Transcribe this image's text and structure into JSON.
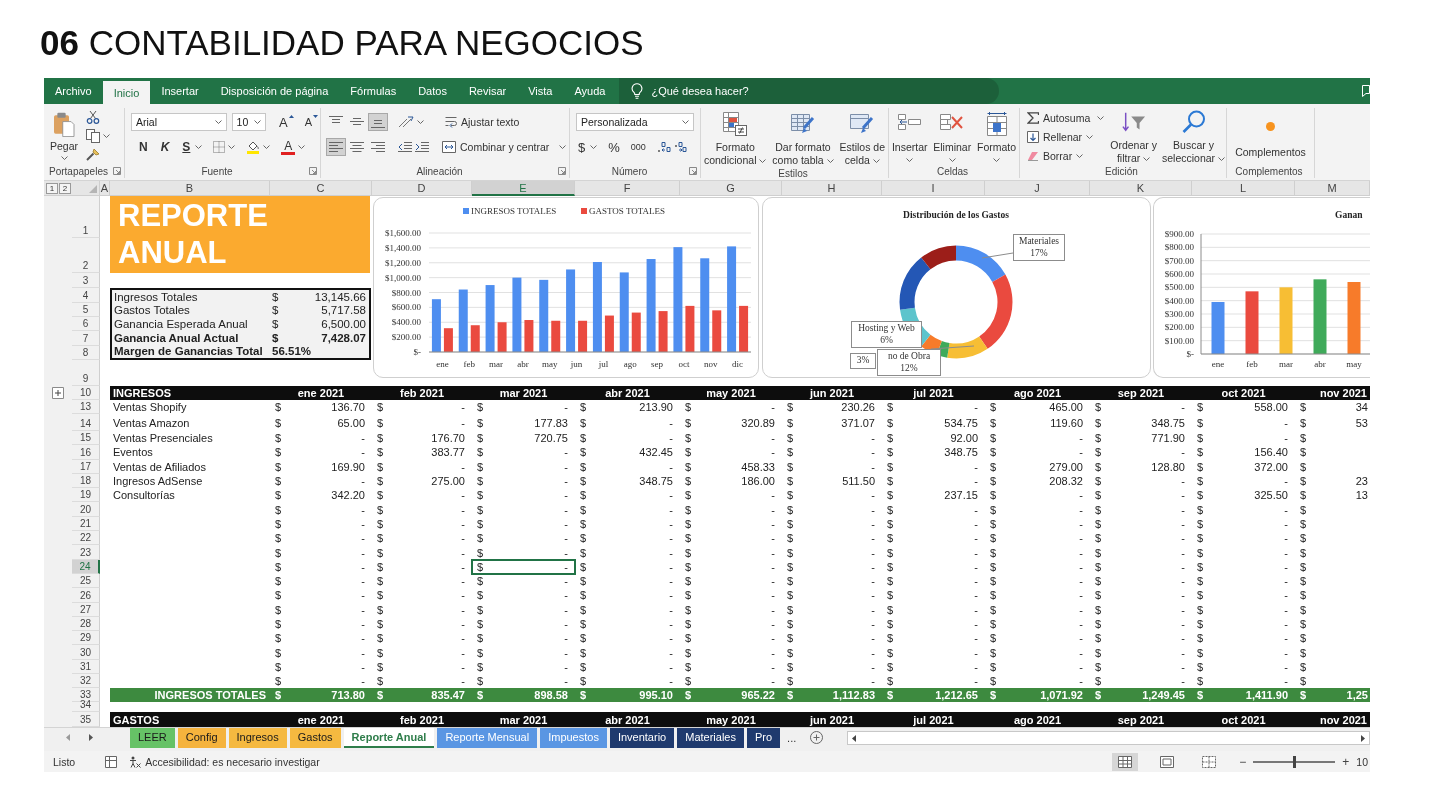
{
  "heading": {
    "text": "**06** CONTABILIDAD PARA NEGOCIOS"
  },
  "menu_tabs": [
    {
      "label": "Archivo",
      "selected": false
    },
    {
      "label": "Inicio",
      "selected": true
    },
    {
      "label": "Insertar",
      "selected": false
    },
    {
      "label": "Disposición de página",
      "selected": false
    },
    {
      "label": "Fórmulas",
      "selected": false
    },
    {
      "label": "Datos",
      "selected": false
    },
    {
      "label": "Revisar",
      "selected": false
    },
    {
      "label": "Vista",
      "selected": false
    },
    {
      "label": "Ayuda",
      "selected": false
    }
  ],
  "tell_me": {
    "placeholder": "¿Qué desea hacer?"
  },
  "ribbon": {
    "clipboard": {
      "paste": "Pegar",
      "group": "Portapapeles"
    },
    "font": {
      "family": "Arial",
      "size": "10",
      "grow": "A",
      "shrink": "A",
      "bold": "N",
      "italic": "K",
      "underline": "S",
      "tint": "A",
      "group": "Fuente"
    },
    "alignment": {
      "vertical": [
        {
          "selected": false
        },
        {
          "selected": false
        },
        {
          "selected": true
        }
      ],
      "wrap": "Ajustar texto",
      "horizontal": [
        {
          "selected": true
        },
        {
          "selected": false
        },
        {
          "selected": false
        }
      ],
      "merge": "Combinar y centrar",
      "group": "Alineación"
    },
    "number": {
      "format": "Personalizada",
      "currency": "$",
      "percent": "%",
      "thousands": "000",
      "group": "Número"
    },
    "styles": {
      "buttons": [
        {
          "lines": [
            "Formato",
            "condicional"
          ]
        },
        {
          "lines": [
            "Dar formato",
            "como tabla"
          ]
        },
        {
          "lines": [
            "Estilos de",
            "celda"
          ]
        }
      ],
      "group": "Estilos"
    },
    "cells": {
      "buttons": [
        "Insertar",
        "Eliminar",
        "Formato"
      ],
      "group": "Celdas"
    },
    "editing": {
      "autosum": "Autosuma",
      "fill": "Rellenar",
      "clear": "Borrar",
      "sort": [
        "Ordenar y",
        "filtrar"
      ],
      "find": [
        "Buscar y",
        "seleccionar"
      ],
      "group": "Edición"
    },
    "addins": {
      "button": "Complementos",
      "group": "Complementos"
    }
  },
  "sheet": {
    "outline_levels": [
      "1",
      "2"
    ],
    "columns": [
      {
        "label": "A",
        "selected": false
      },
      {
        "label": "B",
        "selected": false
      },
      {
        "label": "C",
        "selected": false
      },
      {
        "label": "D",
        "selected": false
      },
      {
        "label": "E",
        "selected": true
      },
      {
        "label": "F",
        "selected": false
      },
      {
        "label": "G",
        "selected": false
      },
      {
        "label": "H",
        "selected": false
      },
      {
        "label": "I",
        "selected": false
      },
      {
        "label": "J",
        "selected": false
      },
      {
        "label": "K",
        "selected": false
      },
      {
        "label": "L",
        "selected": false
      },
      {
        "label": "M",
        "selected": false
      }
    ],
    "row_headers": [
      {
        "number": "1",
        "selected": false
      },
      {
        "number": "2",
        "selected": false
      },
      {
        "number": "3",
        "selected": false
      },
      {
        "number": "4",
        "selected": false
      },
      {
        "number": "5",
        "selected": false
      },
      {
        "number": "6",
        "selected": false
      },
      {
        "number": "7",
        "selected": false
      },
      {
        "number": "8",
        "selected": false
      },
      {
        "number": "9",
        "selected": false
      },
      {
        "number": "10",
        "selected": false
      },
      {
        "number": "13",
        "selected": false
      },
      {
        "number": "14",
        "selected": false
      },
      {
        "number": "15",
        "selected": false
      },
      {
        "number": "16",
        "selected": false
      },
      {
        "number": "17",
        "selected": false
      },
      {
        "number": "18",
        "selected": false
      },
      {
        "number": "19",
        "selected": false
      },
      {
        "number": "20",
        "selected": false
      },
      {
        "number": "21",
        "selected": false
      },
      {
        "number": "22",
        "selected": false
      },
      {
        "number": "23",
        "selected": false
      },
      {
        "number": "24",
        "selected": true
      },
      {
        "number": "25",
        "selected": false
      },
      {
        "number": "26",
        "selected": false
      },
      {
        "number": "27",
        "selected": false
      },
      {
        "number": "28",
        "selected": false
      },
      {
        "number": "29",
        "selected": false
      },
      {
        "number": "30",
        "selected": false
      },
      {
        "number": "31",
        "selected": false
      },
      {
        "number": "32",
        "selected": false
      },
      {
        "number": "33",
        "selected": false
      },
      {
        "number": "34",
        "selected": false
      },
      {
        "number": "35",
        "selected": false
      }
    ],
    "report_title": [
      "REPORTE",
      "ANUAL"
    ],
    "summary": [
      {
        "label": "Ingresos Totales",
        "currency": "$",
        "value": "13,145.66",
        "bold": false
      },
      {
        "label": "Gastos Totales",
        "currency": "$",
        "value": "5,717.58",
        "bold": false
      },
      {
        "label": "Ganancia Esperada Anual",
        "currency": "$",
        "value": "6,500.00",
        "bold": false
      },
      {
        "label": "Ganancia Anual Actual",
        "currency": "$",
        "value": "7,428.07",
        "bold": true
      },
      {
        "label": "Margen de Ganancias Total",
        "value": "56.51%",
        "bold": true
      }
    ],
    "income_chart": {
      "chart_data": {
        "type": "bar",
        "categories": [
          "ene",
          "feb",
          "mar",
          "abr",
          "may",
          "jun",
          "jul",
          "ago",
          "sep",
          "oct",
          "nov",
          "dic"
        ],
        "series": [
          {
            "name": "INGRESOS TOTALES",
            "color": "#4e8ef0",
            "values": [
              710,
              840,
              900,
              1000,
              970,
              1110,
              1210,
              1070,
              1250,
              1410,
              1260,
              1420
            ]
          },
          {
            "name": "GASTOS TOTALES",
            "color": "#ea4a3f",
            "values": [
              320,
              360,
              400,
              430,
              420,
              420,
              490,
              530,
              550,
              620,
              560,
              620
            ]
          }
        ],
        "legend": "top",
        "grid": true,
        "ylim": [
          0,
          1600
        ],
        "yticks": [
          {
            "value": 0,
            "label": "$-"
          },
          {
            "value": 200,
            "label": "$200.00"
          },
          {
            "value": 400,
            "label": "$400.00"
          },
          {
            "value": 600,
            "label": "$600.00"
          },
          {
            "value": 800,
            "label": "$800.00"
          },
          {
            "value": 1000,
            "label": "$1,000.00"
          },
          {
            "value": 1200,
            "label": "$1,200.00"
          },
          {
            "value": 1400,
            "label": "$1,400.00"
          },
          {
            "value": 1600,
            "label": "$1,600.00"
          }
        ]
      }
    },
    "expense_distribution": {
      "title": "Distribución de los Gastos",
      "slices": [
        {
          "color": "#4e8ef0"
        },
        {
          "color": "#ea4a3f"
        },
        {
          "color": "#f7be34"
        },
        {
          "color": "#3faa5a"
        },
        {
          "color": "#f77b2a"
        },
        {
          "color": "#5cc4cc"
        },
        {
          "color": "#2457b5"
        },
        {
          "color": "#9c1e19"
        }
      ],
      "callouts": [
        {
          "name": "Materiales",
          "value": "17%"
        },
        {
          "name": "Hosting y Web",
          "value": "6%"
        },
        {
          "value": "3%"
        },
        {
          "name": "no de Obra",
          "value": "12%"
        }
      ]
    },
    "profit_chart": {
      "chart_data": {
        "type": "bar",
        "title": "Ganan",
        "categories": [
          "ene",
          "feb",
          "mar",
          "abr",
          "may"
        ],
        "series": [
          {
            "values": [
              390,
              470,
              500,
              560,
              540
            ]
          }
        ],
        "colors": [
          "#4e8ef0",
          "#ea4a3f",
          "#f7be34",
          "#3faa5a",
          "#f77b2a"
        ],
        "grid": true,
        "ylim": [
          0,
          900
        ],
        "yticks": [
          {
            "value": 0,
            "label": "$-"
          },
          {
            "value": 100,
            "label": "$100.00"
          },
          {
            "value": 200,
            "label": "$200.00"
          },
          {
            "value": 300,
            "label": "$300.00"
          },
          {
            "value": 400,
            "label": "$400.00"
          },
          {
            "value": 500,
            "label": "$500.00"
          },
          {
            "value": 600,
            "label": "$600.00"
          },
          {
            "value": 700,
            "label": "$700.00"
          },
          {
            "value": 800,
            "label": "$800.00"
          },
          {
            "value": 900,
            "label": "$900.00"
          }
        ]
      }
    },
    "income": {
      "title": "INGRESOS",
      "months": [
        "ene 2021",
        "feb 2021",
        "mar 2021",
        "abr 2021",
        "may 2021",
        "jun 2021",
        "jul 2021",
        "ago 2021",
        "sep 2021",
        "oct 2021",
        "nov 2021"
      ],
      "rows": [
        {
          "label": "Ventas Shopify",
          "cells": [
            [
              "$",
              "136.70"
            ],
            [
              "$",
              "-"
            ],
            [
              "$",
              "-"
            ],
            [
              "$",
              "213.90"
            ],
            [
              "$",
              "-"
            ],
            [
              "$",
              "230.26"
            ],
            [
              "$",
              "-"
            ],
            [
              "$",
              "465.00"
            ],
            [
              "$",
              "-"
            ],
            [
              "$",
              "558.00"
            ],
            [
              "$",
              "34"
            ]
          ]
        },
        {
          "label": "Ventas Amazon",
          "cells": [
            [
              "$",
              "65.00"
            ],
            [
              "$",
              "-"
            ],
            [
              "$",
              "177.83"
            ],
            [
              "$",
              "-"
            ],
            [
              "$",
              "320.89"
            ],
            [
              "$",
              "371.07"
            ],
            [
              "$",
              "534.75"
            ],
            [
              "$",
              "119.60"
            ],
            [
              "$",
              "348.75"
            ],
            [
              "$",
              "-"
            ],
            [
              "$",
              "53"
            ]
          ]
        },
        {
          "label": "Ventas Presenciales",
          "cells": [
            [
              "$",
              "-"
            ],
            [
              "$",
              "176.70"
            ],
            [
              "$",
              "720.75"
            ],
            [
              "$",
              "-"
            ],
            [
              "$",
              "-"
            ],
            [
              "$",
              "-"
            ],
            [
              "$",
              "92.00"
            ],
            [
              "$",
              "-"
            ],
            [
              "$",
              "771.90"
            ],
            [
              "$",
              "-"
            ],
            [
              "$"
            ]
          ]
        },
        {
          "label": "Eventos",
          "cells": [
            [
              "$",
              "-"
            ],
            [
              "$",
              "383.77"
            ],
            [
              "$",
              "-"
            ],
            [
              "$",
              "432.45"
            ],
            [
              "$",
              "-"
            ],
            [
              "$",
              "-"
            ],
            [
              "$",
              "348.75"
            ],
            [
              "$",
              "-"
            ],
            [
              "$",
              "-"
            ],
            [
              "$",
              "156.40"
            ],
            [
              "$"
            ]
          ]
        },
        {
          "label": "Ventas de Afiliados",
          "cells": [
            [
              "$",
              "169.90"
            ],
            [
              "$",
              "-"
            ],
            [
              "$",
              "-"
            ],
            [
              "$",
              "-"
            ],
            [
              "$",
              "458.33"
            ],
            [
              "$",
              "-"
            ],
            [
              "$",
              "-"
            ],
            [
              "$",
              "279.00"
            ],
            [
              "$",
              "128.80"
            ],
            [
              "$",
              "372.00"
            ],
            [
              "$"
            ]
          ]
        },
        {
          "label": "Ingresos AdSense",
          "cells": [
            [
              "$",
              "-"
            ],
            [
              "$",
              "275.00"
            ],
            [
              "$",
              "-"
            ],
            [
              "$",
              "348.75"
            ],
            [
              "$",
              "186.00"
            ],
            [
              "$",
              "511.50"
            ],
            [
              "$",
              "-"
            ],
            [
              "$",
              "208.32"
            ],
            [
              "$",
              "-"
            ],
            [
              "$",
              "-"
            ],
            [
              "$",
              "23"
            ]
          ]
        },
        {
          "label": "Consultorías",
          "cells": [
            [
              "$",
              "342.20"
            ],
            [
              "$",
              "-"
            ],
            [
              "$",
              "-"
            ],
            [
              "$",
              "-"
            ],
            [
              "$",
              "-"
            ],
            [
              "$",
              "-"
            ],
            [
              "$",
              "237.15"
            ],
            [
              "$",
              "-"
            ],
            [
              "$",
              "-"
            ],
            [
              "$",
              "325.50"
            ],
            [
              "$",
              "13"
            ]
          ]
        },
        {
          "cells": [
            [
              "$",
              "-"
            ],
            [
              "$",
              "-"
            ],
            [
              "$",
              "-"
            ],
            [
              "$",
              "-"
            ],
            [
              "$",
              "-"
            ],
            [
              "$",
              "-"
            ],
            [
              "$",
              "-"
            ],
            [
              "$",
              "-"
            ],
            [
              "$",
              "-"
            ],
            [
              "$",
              "-"
            ],
            [
              "$"
            ]
          ]
        },
        {
          "cells": [
            [
              "$",
              "-"
            ],
            [
              "$",
              "-"
            ],
            [
              "$",
              "-"
            ],
            [
              "$",
              "-"
            ],
            [
              "$",
              "-"
            ],
            [
              "$",
              "-"
            ],
            [
              "$",
              "-"
            ],
            [
              "$",
              "-"
            ],
            [
              "$",
              "-"
            ],
            [
              "$",
              "-"
            ],
            [
              "$"
            ]
          ]
        },
        {
          "cells": [
            [
              "$",
              "-"
            ],
            [
              "$",
              "-"
            ],
            [
              "$",
              "-"
            ],
            [
              "$",
              "-"
            ],
            [
              "$",
              "-"
            ],
            [
              "$",
              "-"
            ],
            [
              "$",
              "-"
            ],
            [
              "$",
              "-"
            ],
            [
              "$",
              "-"
            ],
            [
              "$",
              "-"
            ],
            [
              "$"
            ]
          ]
        },
        {
          "cells": [
            [
              "$",
              "-"
            ],
            [
              "$",
              "-"
            ],
            [
              "$",
              "-"
            ],
            [
              "$",
              "-"
            ],
            [
              "$",
              "-"
            ],
            [
              "$",
              "-"
            ],
            [
              "$",
              "-"
            ],
            [
              "$",
              "-"
            ],
            [
              "$",
              "-"
            ],
            [
              "$",
              "-"
            ],
            [
              "$"
            ]
          ]
        },
        {
          "cells": [
            [
              "$",
              "-"
            ],
            [
              "$",
              "-"
            ],
            [
              "$",
              "-"
            ],
            [
              "$",
              "-"
            ],
            [
              "$",
              "-"
            ],
            [
              "$",
              "-"
            ],
            [
              "$",
              "-"
            ],
            [
              "$",
              "-"
            ],
            [
              "$",
              "-"
            ],
            [
              "$",
              "-"
            ],
            [
              "$"
            ]
          ]
        },
        {
          "cells": [
            [
              "$",
              "-"
            ],
            [
              "$",
              "-"
            ],
            [
              "$",
              "-"
            ],
            [
              "$",
              "-"
            ],
            [
              "$",
              "-"
            ],
            [
              "$",
              "-"
            ],
            [
              "$",
              "-"
            ],
            [
              "$",
              "-"
            ],
            [
              "$",
              "-"
            ],
            [
              "$",
              "-"
            ],
            [
              "$"
            ]
          ]
        },
        {
          "cells": [
            [
              "$",
              "-"
            ],
            [
              "$",
              "-"
            ],
            [
              "$",
              "-"
            ],
            [
              "$",
              "-"
            ],
            [
              "$",
              "-"
            ],
            [
              "$",
              "-"
            ],
            [
              "$",
              "-"
            ],
            [
              "$",
              "-"
            ],
            [
              "$",
              "-"
            ],
            [
              "$",
              "-"
            ],
            [
              "$"
            ]
          ]
        },
        {
          "cells": [
            [
              "$",
              "-"
            ],
            [
              "$",
              "-"
            ],
            [
              "$",
              "-"
            ],
            [
              "$",
              "-"
            ],
            [
              "$",
              "-"
            ],
            [
              "$",
              "-"
            ],
            [
              "$",
              "-"
            ],
            [
              "$",
              "-"
            ],
            [
              "$",
              "-"
            ],
            [
              "$",
              "-"
            ],
            [
              "$"
            ]
          ]
        },
        {
          "cells": [
            [
              "$",
              "-"
            ],
            [
              "$",
              "-"
            ],
            [
              "$",
              "-"
            ],
            [
              "$",
              "-"
            ],
            [
              "$",
              "-"
            ],
            [
              "$",
              "-"
            ],
            [
              "$",
              "-"
            ],
            [
              "$",
              "-"
            ],
            [
              "$",
              "-"
            ],
            [
              "$",
              "-"
            ],
            [
              "$"
            ]
          ]
        },
        {
          "cells": [
            [
              "$",
              "-"
            ],
            [
              "$",
              "-"
            ],
            [
              "$",
              "-"
            ],
            [
              "$",
              "-"
            ],
            [
              "$",
              "-"
            ],
            [
              "$",
              "-"
            ],
            [
              "$",
              "-"
            ],
            [
              "$",
              "-"
            ],
            [
              "$",
              "-"
            ],
            [
              "$",
              "-"
            ],
            [
              "$"
            ]
          ]
        },
        {
          "cells": [
            [
              "$",
              "-"
            ],
            [
              "$",
              "-"
            ],
            [
              "$",
              "-"
            ],
            [
              "$",
              "-"
            ],
            [
              "$",
              "-"
            ],
            [
              "$",
              "-"
            ],
            [
              "$",
              "-"
            ],
            [
              "$",
              "-"
            ],
            [
              "$",
              "-"
            ],
            [
              "$",
              "-"
            ],
            [
              "$"
            ]
          ]
        },
        {
          "cells": [
            [
              "$",
              "-"
            ],
            [
              "$",
              "-"
            ],
            [
              "$",
              "-"
            ],
            [
              "$",
              "-"
            ],
            [
              "$",
              "-"
            ],
            [
              "$",
              "-"
            ],
            [
              "$",
              "-"
            ],
            [
              "$",
              "-"
            ],
            [
              "$",
              "-"
            ],
            [
              "$",
              "-"
            ],
            [
              "$"
            ]
          ]
        },
        {
          "cells": [
            [
              "$",
              "-"
            ],
            [
              "$",
              "-"
            ],
            [
              "$",
              "-"
            ],
            [
              "$",
              "-"
            ],
            [
              "$",
              "-"
            ],
            [
              "$",
              "-"
            ],
            [
              "$",
              "-"
            ],
            [
              "$",
              "-"
            ],
            [
              "$",
              "-"
            ],
            [
              "$",
              "-"
            ],
            [
              "$"
            ]
          ]
        }
      ],
      "total": {
        "label": "INGRESOS TOTALES",
        "cells": [
          [
            "$",
            "713.80"
          ],
          [
            "$",
            "835.47"
          ],
          [
            "$",
            "898.58"
          ],
          [
            "$",
            "995.10"
          ],
          [
            "$",
            "965.22"
          ],
          [
            "$",
            "1,112.83"
          ],
          [
            "$",
            "1,212.65"
          ],
          [
            "$",
            "1,071.92"
          ],
          [
            "$",
            "1,249.45"
          ],
          [
            "$",
            "1,411.90"
          ],
          [
            "$",
            "1,25"
          ]
        ]
      }
    },
    "expenses": {
      "title": "GASTOS",
      "months": [
        "ene 2021",
        "feb 2021",
        "mar 2021",
        "abr 2021",
        "may 2021",
        "jun 2021",
        "jul 2021",
        "ago 2021",
        "sep 2021",
        "oct 2021",
        "nov 2021"
      ]
    }
  },
  "sheet_tabs": [
    {
      "label": "LEER",
      "color": "#66c266",
      "selected": false
    },
    {
      "label": "Config",
      "color": "#f5b33d",
      "selected": false
    },
    {
      "label": "Ingresos",
      "color": "#f5b940",
      "selected": false
    },
    {
      "label": "Gastos",
      "color": "#f5b940",
      "selected": false
    },
    {
      "label": "Reporte Anual",
      "color": "#2e7d4a",
      "selected": true
    },
    {
      "label": "Reporte Mensual",
      "color": "#5a96e3",
      "selected": false
    },
    {
      "label": "Impuestos",
      "color": "#5a96e3",
      "selected": false
    },
    {
      "label": "Inventario",
      "color": "#1f3a6e",
      "selected": false
    },
    {
      "label": "Materiales",
      "color": "#1f3a6e",
      "selected": false
    },
    {
      "label": "Pro",
      "color": "#1f3a6e",
      "selected": false
    }
  ],
  "more_tabs": "...",
  "status_bar": {
    "status": "Listo",
    "accessibility": "Accesibilidad: es necesario investigar",
    "views": [
      {
        "selected": true
      },
      {
        "selected": false
      },
      {
        "selected": false
      }
    ],
    "zoom": {
      "minus": "−",
      "plus": "+",
      "level": 0.5,
      "value": "10"
    }
  }
}
